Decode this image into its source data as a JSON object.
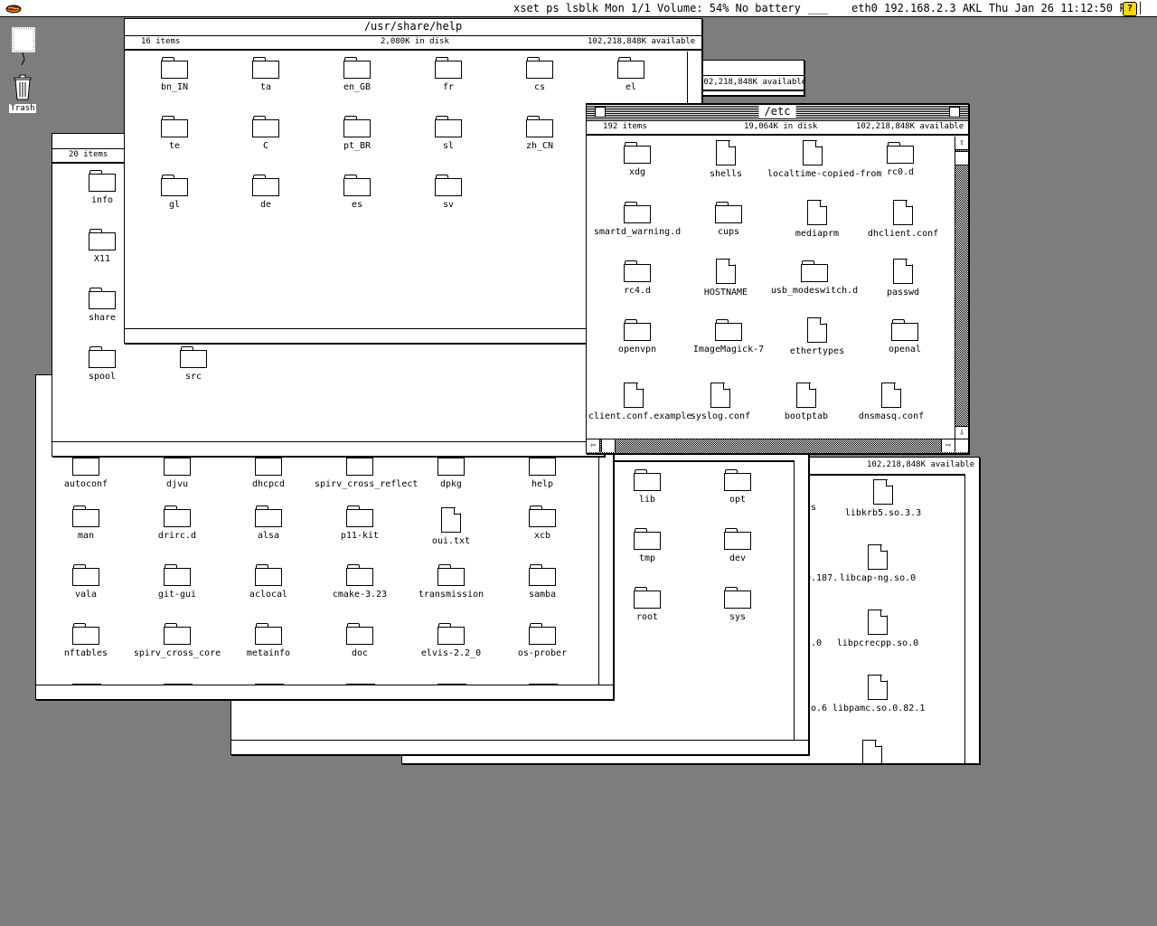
{
  "menubar": {
    "apple_icon": "apple-hotdog-icon",
    "status_left": "xset ps lsblk Mon 1/1 Volume: 54%  No battery",
    "status_net": "eth0 192.168.2.3 AKL Thu Jan 26 11:12:50 PM",
    "help_label": "?"
  },
  "desktop": {
    "trash_label": "Trash"
  },
  "win_back_right": {
    "available": "102,218,848K available",
    "items": [
      "libkrb5.so.3.3",
      "libcap-ng.so.0",
      "libpcrecpp.so.0",
      "libpamc.so.0.82.1"
    ],
    "left_fragments": [
      "gs",
      "0.187.",
      "2.0",
      "so.6"
    ]
  },
  "win_root": {
    "available": "102,218,848K available",
    "items": [
      "lib",
      "opt",
      "tmp",
      "dev",
      "root",
      "sys"
    ]
  },
  "win_usr_share": {
    "items": [
      "autoconf",
      "djvu",
      "dhcpcd",
      "spirv_cross_reflect",
      "dpkg",
      "help",
      "man",
      "drirc.d",
      "alsa",
      "p11-kit",
      "oui.txt",
      "xcb",
      "vala",
      "git-gui",
      "aclocal",
      "cmake-3.23",
      "transmission",
      "samba",
      "nftables",
      "spirv_cross_core",
      "metainfo",
      "doc",
      "elvis-2.2_0",
      "os-prober"
    ]
  },
  "win_usr": {
    "count": "20 items",
    "items": [
      "info",
      "X11",
      "share",
      "spool",
      "src"
    ]
  },
  "win_tr": {
    "available": "102,218,848K available"
  },
  "win_help": {
    "title": "/usr/share/help",
    "count": "16 items",
    "disk": "2,080K  in disk",
    "available": "102,218,848K available",
    "items": [
      "bn_IN",
      "ta",
      "en_GB",
      "fr",
      "cs",
      "el",
      "te",
      "C",
      "pt_BR",
      "sl",
      "zh_CN",
      "gl",
      "de",
      "es",
      "sv"
    ]
  },
  "win_etc": {
    "title": "/etc",
    "count": "192 items",
    "disk": "19,064K  in disk",
    "available": "102,218,848K available",
    "items": [
      "xdg",
      "shells",
      "localtime-copied-from",
      "rc0.d",
      "smartd_warning.d",
      "cups",
      "mediaprm",
      "dhclient.conf",
      "rc4.d",
      "HOSTNAME",
      "usb_modeswitch.d",
      "passwd",
      "openvpn",
      "ImageMagick-7",
      "ethertypes",
      "openal",
      "client.conf.example",
      "syslog.conf",
      "bootptab",
      "dnsmasq.conf"
    ]
  }
}
